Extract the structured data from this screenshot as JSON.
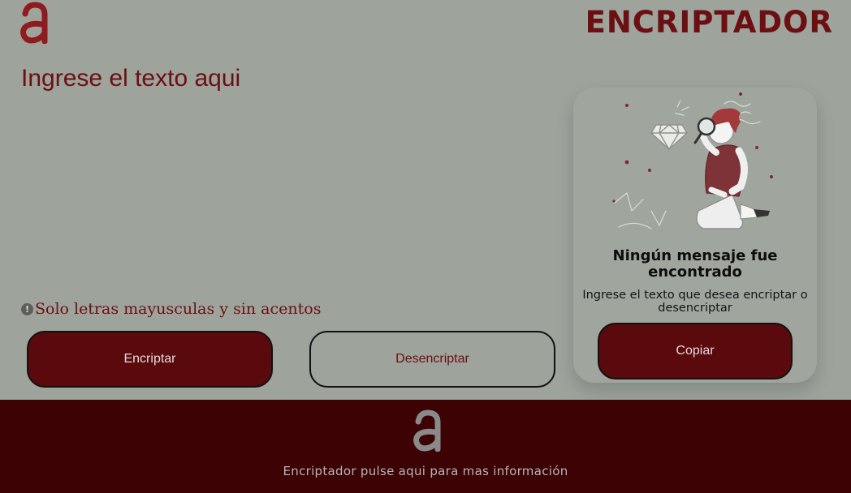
{
  "header": {
    "logo_icon": "letter-a-logo-icon",
    "title": "ENCRIPTADOR"
  },
  "input": {
    "placeholder": "Ingrese el texto aqui",
    "value": ""
  },
  "warning": {
    "icon": "exclamation-circle-icon",
    "text": "Solo letras mayusculas y sin acentos"
  },
  "buttons": {
    "encrypt_label": "Encriptar",
    "decrypt_label": "Desencriptar",
    "copy_label": "Copiar"
  },
  "result": {
    "illustration_icon": "person-with-magnifier-illustration",
    "title": "Ningún mensaje fue encontrado",
    "subtitle": "Ingrese el texto que desea encriptar o desencriptar"
  },
  "footer": {
    "logo_icon": "letter-a-logo-icon",
    "link_text": "Encriptador pulse aqui para mas información"
  },
  "colors": {
    "background": "#9ea39c",
    "accent": "#5a0a0c",
    "title": "#6b0f13",
    "footer_bg": "#3c0204"
  }
}
